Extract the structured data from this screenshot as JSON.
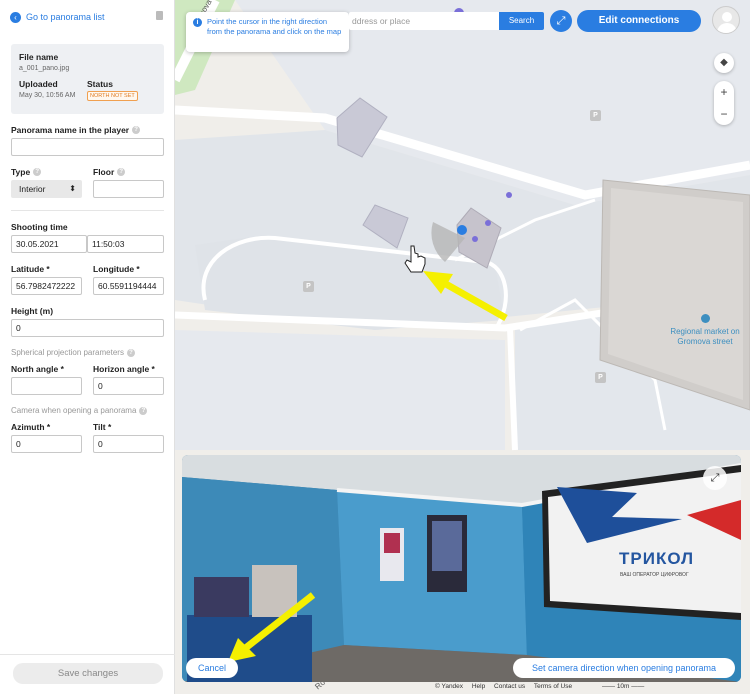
{
  "sidebar": {
    "back_label": "Go to panorama list",
    "file_card": {
      "file_name_label": "File name",
      "file_name": "a_001_pano.jpg",
      "uploaded_label": "Uploaded",
      "uploaded_value": "May 30, 10:56 AM",
      "status_label": "Status",
      "status_value": "NORTH NOT SET"
    },
    "panorama_name_label": "Panorama name in the player",
    "panorama_name_value": "",
    "type_label": "Type",
    "type_value": "Interior",
    "floor_label": "Floor",
    "floor_value": "",
    "shooting_time_label": "Shooting time",
    "shooting_date": "30.05.2021",
    "shooting_clock": "11:50:03",
    "latitude_label": "Latitude *",
    "latitude_value": "56.7982472222",
    "longitude_label": "Longitude *",
    "longitude_value": "60.5591194444",
    "height_label": "Height (m)",
    "height_value": "0",
    "spherical_label": "Spherical projection parameters",
    "north_angle_label": "North angle *",
    "north_angle_value": "",
    "horizon_angle_label": "Horizon angle *",
    "horizon_angle_value": "0",
    "camera_section_label": "Camera when opening a panorama",
    "azimuth_label": "Azimuth *",
    "azimuth_value": "0",
    "tilt_label": "Tilt *",
    "tilt_value": "0",
    "save_label": "Save changes"
  },
  "map": {
    "tooltip_text": "Point the cursor in the right direction from the panorama and click on the map",
    "search_placeholder": "ddress or place",
    "search_label": "Search",
    "edit_connections_label": "Edit connections",
    "street_label": "Gromova",
    "street_label_2": "Ro",
    "market_label": "Regional market on Gromova street",
    "parking_letter": "P",
    "zoom_in": "+",
    "zoom_out": "−"
  },
  "panorama": {
    "tv_brand": "ТРИКОЛ",
    "tv_slogan": "ВАШ ОПЕРАТОР ЦИФРОВОГ",
    "cancel_label": "Cancel",
    "set_direction_label": "Set camera direction when opening panorama"
  },
  "footer": {
    "copyright": "© Yandex",
    "help": "Help",
    "contact": "Contact us",
    "terms": "Terms of Use",
    "scale": "10m"
  },
  "colors": {
    "accent": "#2a7de1",
    "status_warning": "#e07a20",
    "annotation_arrow": "#f5f000"
  }
}
